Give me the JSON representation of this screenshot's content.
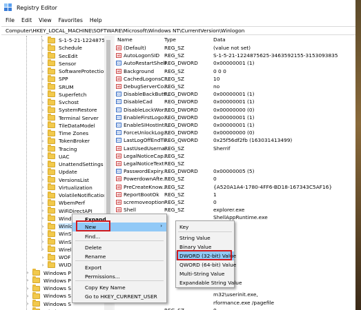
{
  "window": {
    "title": "Registry Editor"
  },
  "menubar": [
    "File",
    "Edit",
    "View",
    "Favorites",
    "Help"
  ],
  "address": "Computer\\HKEY_LOCAL_MACHINE\\SOFTWARE\\Microsoft\\Windows NT\\CurrentVersion\\Winlogon",
  "tree": {
    "items": [
      "S-1-5-21-1224875625",
      "Schedule",
      "SecEdit",
      "Sensor",
      "SoftwareProtectionP",
      "SPP",
      "SRUM",
      "Superfetch",
      "Svchost",
      "SystemRestore",
      "Terminal Server",
      "TileDataModel",
      "Time Zones",
      "TokenBroker",
      "Tracing",
      "UAC",
      "UnattendSettings",
      "Update",
      "VersionsList",
      "Virtualization",
      "VolatileNotifications",
      "WbemPerf",
      "WiFiDirectAPI",
      "Windows",
      "Winlogon",
      "WinS",
      "WinS",
      "Wirel",
      "WOF",
      "WUD",
      "Windows P",
      "Windows P",
      "Windows S",
      "Windows S",
      "Windows S",
      "Windows S"
    ],
    "selected_index": 24
  },
  "list": {
    "headers": {
      "name": "Name",
      "type": "Type",
      "data": "Data"
    },
    "rows": [
      {
        "icon": "string",
        "name": "(Default)",
        "type": "REG_SZ",
        "data": "(value not set)"
      },
      {
        "icon": "string",
        "name": "AutoLogonSID",
        "type": "REG_SZ",
        "data": "S-1-5-21-1224875625-3463592155-3153093835"
      },
      {
        "icon": "binary",
        "name": "AutoRestartShell",
        "type": "REG_DWORD",
        "data": "0x00000001 (1)"
      },
      {
        "icon": "string",
        "name": "Background",
        "type": "REG_SZ",
        "data": "0 0 0"
      },
      {
        "icon": "string",
        "name": "CachedLogonsC...",
        "type": "REG_SZ",
        "data": "10"
      },
      {
        "icon": "string",
        "name": "DebugServerCo...",
        "type": "REG_SZ",
        "data": "no"
      },
      {
        "icon": "binary",
        "name": "DisableBackButt...",
        "type": "REG_DWORD",
        "data": "0x00000001 (1)"
      },
      {
        "icon": "binary",
        "name": "DisableCad",
        "type": "REG_DWORD",
        "data": "0x00000001 (1)"
      },
      {
        "icon": "binary",
        "name": "DisableLockWor...",
        "type": "REG_DWORD",
        "data": "0x00000000 (0)"
      },
      {
        "icon": "binary",
        "name": "EnableFirstLogo...",
        "type": "REG_DWORD",
        "data": "0x00000001 (1)"
      },
      {
        "icon": "binary",
        "name": "EnableSIHostInt...",
        "type": "REG_DWORD",
        "data": "0x00000001 (1)"
      },
      {
        "icon": "binary",
        "name": "ForceUnlockLog...",
        "type": "REG_DWORD",
        "data": "0x00000000 (0)"
      },
      {
        "icon": "binary",
        "name": "LastLogOffEndTi...",
        "type": "REG_QWORD",
        "data": "0x25f56df2fb (163031413499)"
      },
      {
        "icon": "string",
        "name": "LastUsedUserna...",
        "type": "REG_SZ",
        "data": "Sherrif"
      },
      {
        "icon": "string",
        "name": "LegalNoticeCap...",
        "type": "REG_SZ",
        "data": ""
      },
      {
        "icon": "string",
        "name": "LegalNoticeText",
        "type": "REG_SZ",
        "data": ""
      },
      {
        "icon": "binary",
        "name": "PasswordExpiry...",
        "type": "REG_DWORD",
        "data": "0x00000005 (5)"
      },
      {
        "icon": "string",
        "name": "PowerdownAfte...",
        "type": "REG_SZ",
        "data": "0"
      },
      {
        "icon": "string",
        "name": "PreCreateKnow...",
        "type": "REG_SZ",
        "data": "{A520A1A4-1780-4FF6-BD18-167343C5AF16}"
      },
      {
        "icon": "string",
        "name": "ReportBootOk",
        "type": "REG_SZ",
        "data": "1"
      },
      {
        "icon": "string",
        "name": "scremoveoption",
        "type": "REG_SZ",
        "data": "0"
      },
      {
        "icon": "string",
        "name": "Shell",
        "type": "REG_SZ",
        "data": "explorer.exe"
      },
      {
        "icon": "string",
        "name": "",
        "type": "",
        "data": "ShellAppRuntime.exe"
      },
      {
        "icon": "",
        "name": "",
        "type": "",
        "data": ""
      },
      {
        "icon": "",
        "name": "",
        "type": "",
        "data": ""
      },
      {
        "icon": "",
        "name": "",
        "type": "",
        "data": ""
      },
      {
        "icon": "",
        "name": "",
        "type": "",
        "data": "84203)"
      },
      {
        "icon": "",
        "name": "",
        "type": "",
        "data": ""
      },
      {
        "icon": "",
        "name": "",
        "type": "",
        "data": ""
      },
      {
        "icon": "",
        "name": "",
        "type": "",
        "data": ""
      },
      {
        "icon": "",
        "name": "",
        "type": "",
        "data": ""
      },
      {
        "icon": "",
        "name": "",
        "type": "",
        "data": ""
      },
      {
        "icon": "",
        "name": "",
        "type": "",
        "data": "m32\\userinit.exe,"
      },
      {
        "icon": "",
        "name": "",
        "type": "",
        "data": "rformance.exe /pagefile"
      },
      {
        "icon": "",
        "name": "",
        "type": "REG_SZ",
        "data": "0"
      }
    ]
  },
  "context_menu": {
    "items": [
      "Expand",
      "New",
      "Find...",
      "Delete",
      "Rename",
      "Export",
      "Permissions...",
      "Copy Key Name",
      "Go to HKEY_CURRENT_USER"
    ],
    "highlighted": "New",
    "submenu_arrow": "›"
  },
  "submenu": {
    "items": [
      "Key",
      "String Value",
      "Binary Value",
      "DWORD (32-bit) Value",
      "QWORD (64-bit) Value",
      "Multi-String Value",
      "Expandable String Value"
    ],
    "highlighted": "DWORD (32-bit) Value"
  },
  "colors": {
    "highlight_red": "#d0191d",
    "menu_hover": "#91c9f7",
    "folder": "#f2c94c"
  }
}
